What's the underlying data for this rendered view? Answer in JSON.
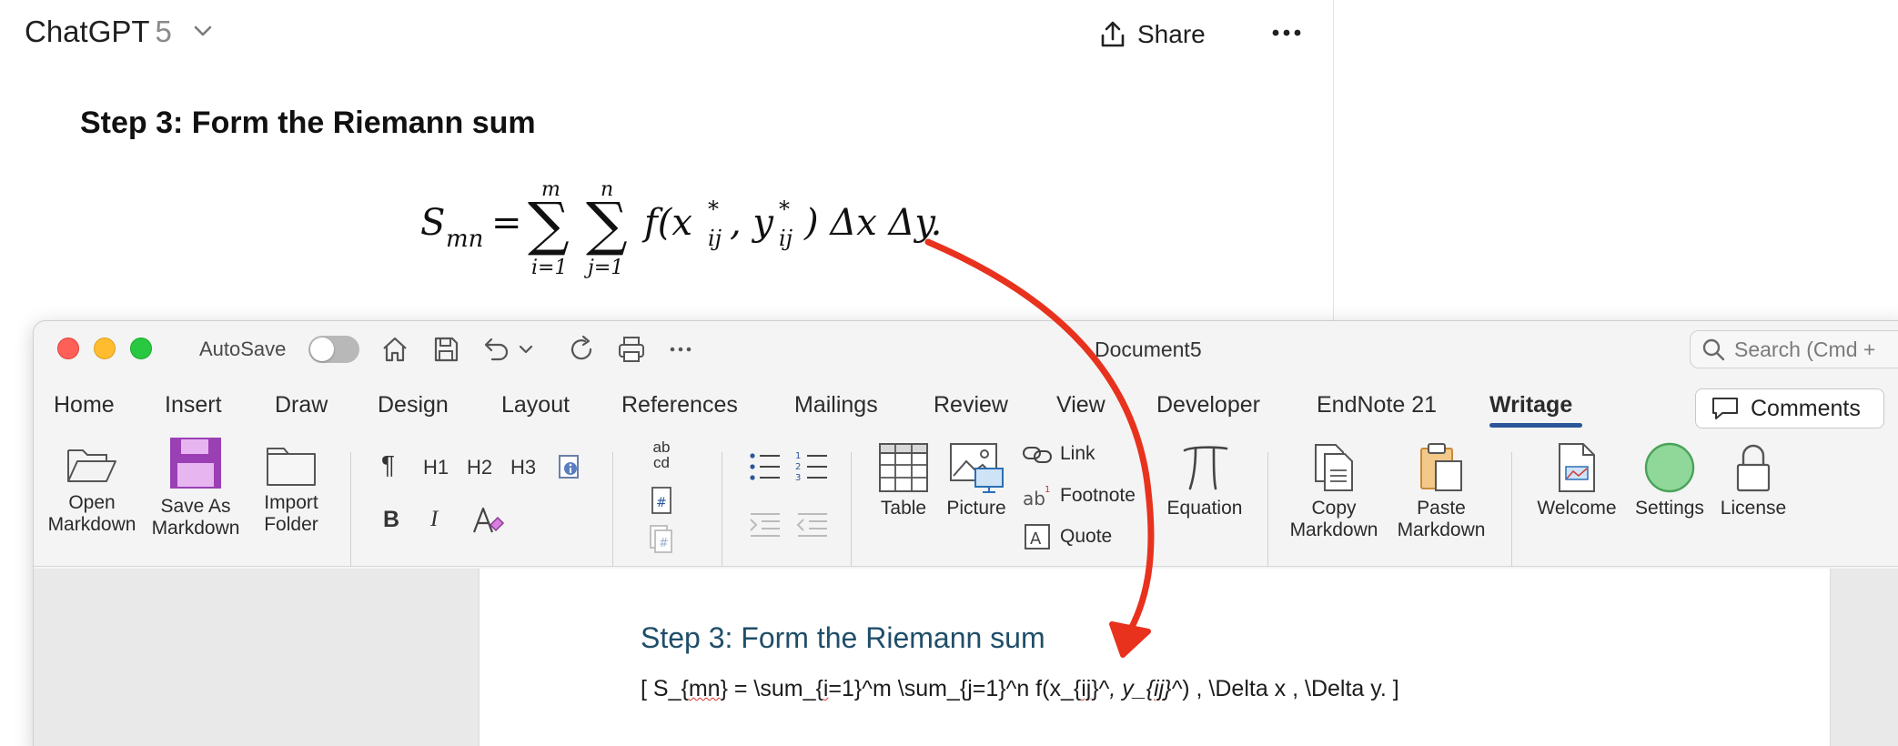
{
  "chatgpt": {
    "app_name": "ChatGPT",
    "model": "5",
    "share_label": "Share",
    "step_heading": "Step 3: Form the Riemann sum",
    "formula": {
      "lhs_base": "S",
      "lhs_sub": "mn",
      "equals": "=",
      "sum1_upper": "m",
      "sum1_lower": "i=1",
      "sum2_upper": "n",
      "sum2_lower": "j=1",
      "sigma": "∑",
      "body": "f(x",
      "star1": "*",
      "sub1": "ij",
      "mid": ", y",
      "star2": "*",
      "sub2": "ij",
      "tail": ") Δx Δy."
    }
  },
  "word": {
    "autosave_label": "AutoSave",
    "document_title": "Document5",
    "search_placeholder": "Search (Cmd +",
    "tabs": [
      "Home",
      "Insert",
      "Draw",
      "Design",
      "Layout",
      "References",
      "Mailings",
      "Review",
      "View",
      "Developer",
      "EndNote 21",
      "Writage"
    ],
    "active_tab": "Writage",
    "comments_label": "Comments",
    "ribbon": {
      "open_markdown": [
        "Open",
        "Markdown"
      ],
      "save_as_markdown": [
        "Save As",
        "Markdown"
      ],
      "import_folder": [
        "Import",
        "Folder"
      ],
      "pilcrow": "¶",
      "h1": "H1",
      "h2": "H2",
      "h3": "H3",
      "bold": "B",
      "italic": "I",
      "abcd_top": "ab",
      "abcd_bottom": "cd",
      "table": "Table",
      "picture": "Picture",
      "link": "Link",
      "footnote": "Footnote",
      "quote": "Quote",
      "equation": "Equation",
      "copy_markdown": [
        "Copy",
        "Markdown"
      ],
      "paste_markdown": [
        "Paste",
        "Markdown"
      ],
      "welcome": "Welcome",
      "settings": "Settings",
      "license": "License"
    },
    "document": {
      "heading": "Step 3: Form the Riemann sum",
      "latex": {
        "p1": "[ S_{",
        "p2": "mn",
        "p3": "} = \\sum_{",
        "p4": "i",
        "p5": "=1}^m \\sum_{j=1}^n f(x_{",
        "p6": "ij",
        "p7": "}^",
        "p8": ", y_{",
        "p9": "ij",
        "p10": "}^",
        "p11": ") , \\Delta x , \\Delta y. ]"
      }
    }
  },
  "colors": {
    "accent_blue": "#2b579a",
    "heading_teal": "#1f4e69",
    "arrow_red": "#e8321e",
    "save_markdown_purple": "#9b3fb5",
    "settings_green": "#8fd89a"
  }
}
